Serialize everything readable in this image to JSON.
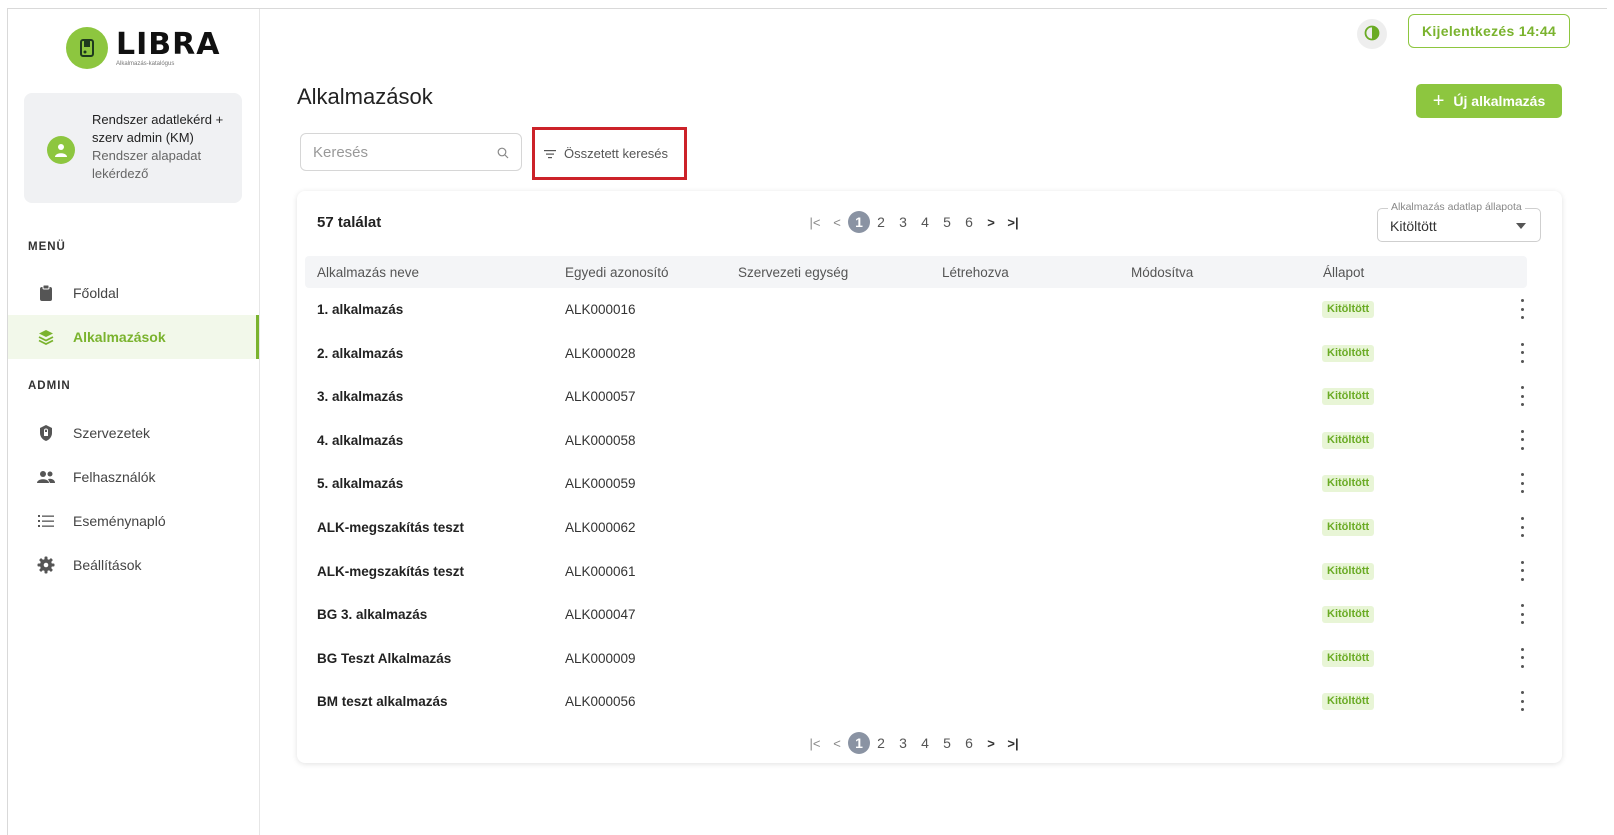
{
  "brand": {
    "title": "LIBRA",
    "subtitle": "Alkalmazás-katalógus"
  },
  "user": {
    "name": "Rendszer adatlekérd + szerv admin (KM)",
    "role": "Rendszer alapadat lekérdező"
  },
  "sidebar": {
    "menu_label": "MENÜ",
    "menu_items": [
      {
        "label": "Főoldal",
        "icon": "clipboard-icon"
      },
      {
        "label": "Alkalmazások",
        "icon": "layers-icon",
        "active": true
      }
    ],
    "admin_label": "ADMIN",
    "admin_items": [
      {
        "label": "Szervezetek",
        "icon": "shield-lock-icon"
      },
      {
        "label": "Felhasználók",
        "icon": "users-icon"
      },
      {
        "label": "Eseménynapló",
        "icon": "list-icon"
      },
      {
        "label": "Beállítások",
        "icon": "gear-icon"
      }
    ]
  },
  "topbar": {
    "logout_label": "Kijelentkezés 14:44"
  },
  "page": {
    "title": "Alkalmazások",
    "new_button_label": "Új alkalmazás",
    "search_placeholder": "Keresés",
    "advanced_search_label": "Összetett keresés"
  },
  "results": {
    "count_label": "57 találat",
    "pagination": {
      "pages": [
        "1",
        "2",
        "3",
        "4",
        "5",
        "6"
      ],
      "current": "1"
    },
    "status_filter": {
      "legend": "Alkalmazás adatlap állapota",
      "value": "Kitöltött"
    },
    "columns": [
      "Alkalmazás neve",
      "Egyedi azonosító",
      "Szervezeti egység",
      "Létrehozva",
      "Módosítva",
      "Állapot"
    ],
    "rows": [
      {
        "name": "1. alkalmazás",
        "code": "ALK000016",
        "status": "Kitöltött"
      },
      {
        "name": "2. alkalmazás",
        "code": "ALK000028",
        "status": "Kitöltött"
      },
      {
        "name": "3. alkalmazás",
        "code": "ALK000057",
        "status": "Kitöltött"
      },
      {
        "name": "4. alkalmazás",
        "code": "ALK000058",
        "status": "Kitöltött"
      },
      {
        "name": "5. alkalmazás",
        "code": "ALK000059",
        "status": "Kitöltött"
      },
      {
        "name": "ALK-megszakítás teszt",
        "code": "ALK000062",
        "status": "Kitöltött"
      },
      {
        "name": "ALK-megszakítás teszt",
        "code": "ALK000061",
        "status": "Kitöltött"
      },
      {
        "name": "BG 3. alkalmazás",
        "code": "ALK000047",
        "status": "Kitöltött"
      },
      {
        "name": "BG Teszt Alkalmazás",
        "code": "ALK000009",
        "status": "Kitöltött"
      },
      {
        "name": "BM teszt alkalmazás",
        "code": "ALK000056",
        "status": "Kitöltött"
      }
    ]
  },
  "colors": {
    "accent": "#8dc63f",
    "accent_dark": "#7ab32e",
    "highlight_box": "#cc2229",
    "pager_current": "#8a93a3"
  }
}
